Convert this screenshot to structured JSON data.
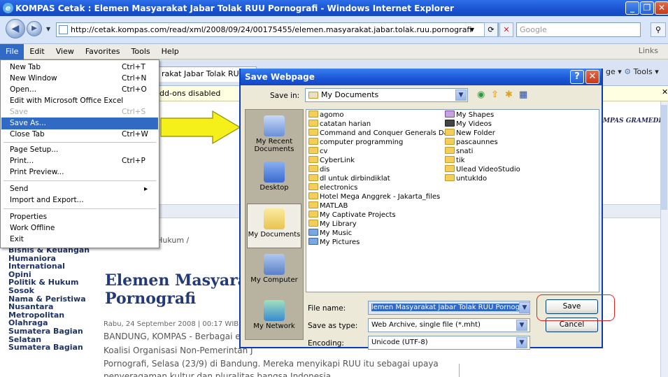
{
  "window": {
    "title": "KOMPAS Cetak : Elemen Masyarakat Jabar Tolak RUU Pornografi - Windows Internet Explorer"
  },
  "address_bar": {
    "url": "http://cetak.kompas.com/read/xml/2008/09/24/00175455/elemen.masyarakat.jabar.tolak.ruu.pornografi",
    "search_placeholder": "Google"
  },
  "menubar": {
    "items": [
      "File",
      "Edit",
      "View",
      "Favorites",
      "Tools",
      "Help"
    ],
    "links": "Links"
  },
  "tab": {
    "label": "rakat Jabar Tolak RUU..."
  },
  "toolbar": {
    "page_label": "ge ▾",
    "tools_label": "Tools ▾"
  },
  "infobar": {
    "text": "dd-ons disabled"
  },
  "file_menu": {
    "items": [
      {
        "label": "New Tab",
        "shortcut": "Ctrl+T"
      },
      {
        "label": "New Window",
        "shortcut": "Ctrl+N"
      },
      {
        "label": "Open...",
        "shortcut": "Ctrl+O"
      },
      {
        "label": "Edit with Microsoft Office Excel",
        "shortcut": ""
      },
      {
        "label": "Save",
        "shortcut": "Ctrl+S"
      },
      {
        "label": "Save As...",
        "shortcut": ""
      },
      {
        "label": "Close Tab",
        "shortcut": "Ctrl+W"
      },
      {
        "label": "Page Setup...",
        "shortcut": ""
      },
      {
        "label": "Print...",
        "shortcut": "Ctrl+P"
      },
      {
        "label": "Print Preview...",
        "shortcut": ""
      },
      {
        "label": "Send",
        "shortcut": "▸"
      },
      {
        "label": "Import and Export...",
        "shortcut": ""
      },
      {
        "label": "Properties",
        "shortcut": ""
      },
      {
        "label": "Work Offline",
        "shortcut": ""
      },
      {
        "label": "Exit",
        "shortcut": ""
      }
    ]
  },
  "page": {
    "brand": "MPAS GRAMEDIA",
    "breadcrumb": "& Hukum /",
    "sidebar": [
      "Bisnis & Keuangan",
      "Humaniora",
      "International",
      "Opini",
      "Politik & Hukum",
      "Sosok",
      "Nama & Peristiwa",
      "Nusantara",
      "Metropolitan",
      "Olahraga",
      "Sumatera Bagian Selatan",
      "Sumatera Bagian"
    ],
    "article_title_1": "Elemen Masyaral",
    "article_title_2": "Pornografi",
    "date": "Rabu, 24 September 2008 | 00:17 WIB",
    "body": [
      "BANDUNG, KOMPAS - Berbagai el",
      "Koalisi Organisasi Non-Pemerintah J",
      "Pornografi, Selasa (23/9) di Bandung. Mereka menyikapi RUU itu sebagai upaya",
      "penyeragaman kultur dan pluralitas bangsa Indonesia."
    ]
  },
  "dialog": {
    "title": "Save Webpage",
    "save_in_label": "Save in:",
    "save_in_value": "My Documents",
    "places": [
      "My Recent Documents",
      "Desktop",
      "My Documents",
      "My Computer",
      "My Network"
    ],
    "files_col1": [
      "agomo",
      "catatan harian",
      "Command and Conquer Generals Data",
      "computer programming",
      "cv",
      "CyberLink",
      "dis",
      "dl untuk dirbindiklat",
      "electronics",
      "Hotel Mega Anggrek - Jakarta_files",
      "MATLAB",
      "My Captivate Projects",
      "My Library",
      "My Music",
      "My Pictures"
    ],
    "files_col2": [
      "My Shapes",
      "My Videos",
      "New Folder",
      "pascaunnes",
      "snati",
      "tik",
      "Ulead VideoStudio",
      "untukIdo"
    ],
    "file_name_label": "File name:",
    "file_name_value": "lemen Masyarakat Jabar Tolak RUU Pornograf",
    "save_as_type_label": "Save as type:",
    "save_as_type_value": "Web Archive, single file (*.mht)",
    "encoding_label": "Encoding:",
    "encoding_value": "Unicode (UTF-8)",
    "save_button": "Save",
    "cancel_button": "Cancel"
  }
}
